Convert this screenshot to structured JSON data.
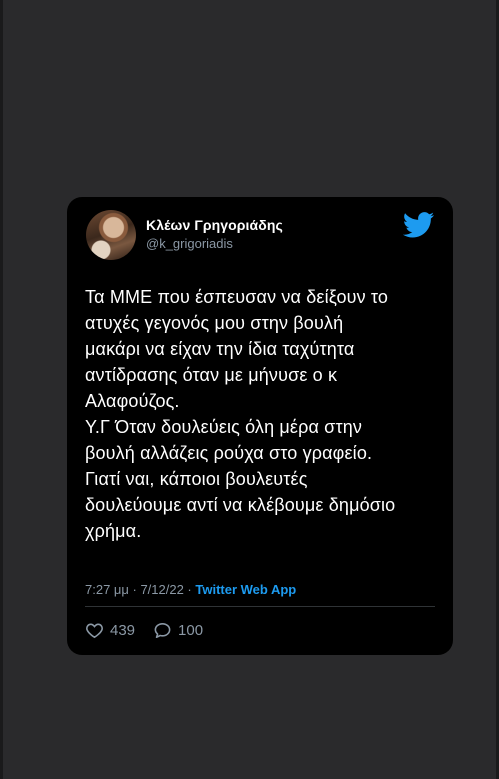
{
  "tweet": {
    "author_name": "Κλέων Γρηγοριάδης",
    "author_handle": "@k_grigoriadis",
    "text": "Τα ΜΜΕ που έσπευσαν να δείξουν το\nατυχές γεγονός μου στην βουλή\nμακάρι να είχαν την ίδια ταχύτητα\nαντίδρασης όταν με μήνυσε ο κ\nΑλαφούζος.\nΥ.Γ Όταν δουλεύεις όλη μέρα στην\nβουλή αλλάζεις ρούχα στο γραφείο.\nΓιατί ναι, κάποιοι βουλευτές\nδουλεύουμε αντί να κλέβουμε δημόσιο\nχρήμα.",
    "timestamp": "7:27 μμ · 7/12/22 · ",
    "source_app": "Twitter Web App",
    "likes": "439",
    "replies": "100",
    "brand_color": "#1d9bf0"
  },
  "icons": {
    "brand": "twitter-bird-icon",
    "likes": "heart-icon",
    "replies": "reply-bubble-icon"
  }
}
